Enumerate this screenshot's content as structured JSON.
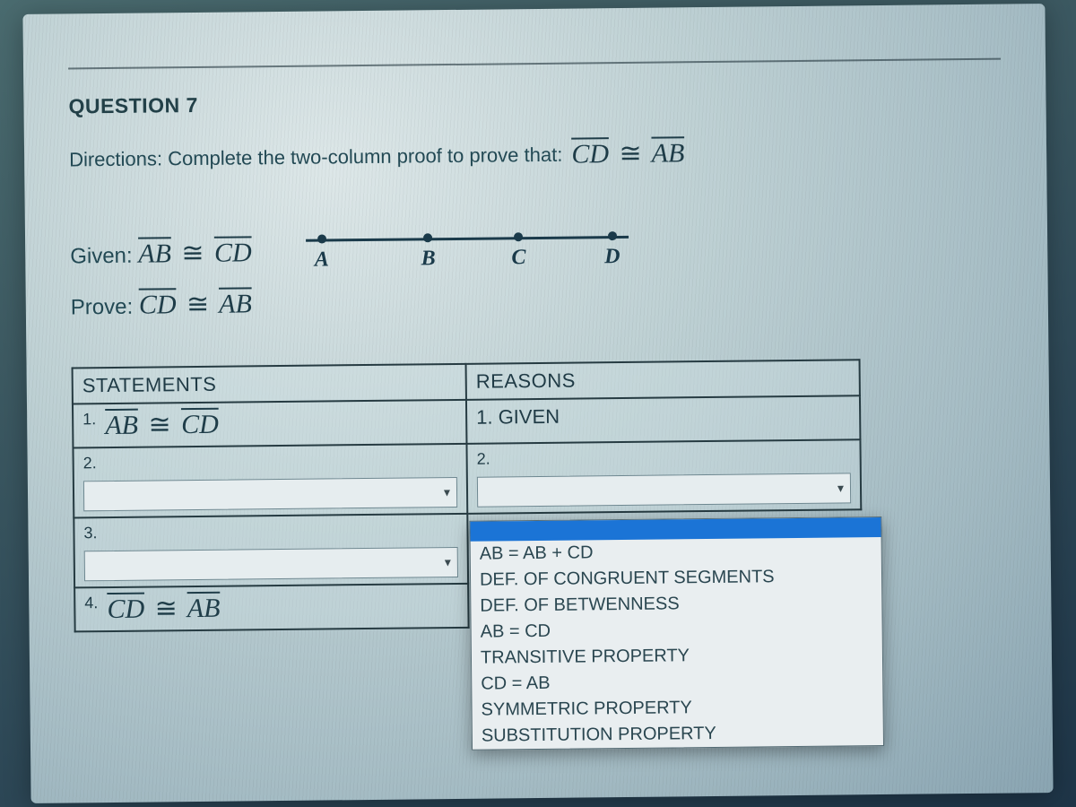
{
  "question": {
    "label": "QUESTION 7",
    "directions_prefix": "Directions: Complete the two-column proof to prove that:",
    "prove_expr_left": "CD",
    "prove_expr_right": "AB"
  },
  "given_prove": {
    "given_label": "Given:",
    "given_left": "AB",
    "given_right": "CD",
    "prove_label": "Prove:",
    "prove_left": "CD",
    "prove_right": "AB"
  },
  "numberline": {
    "points": [
      "A",
      "B",
      "C",
      "D"
    ]
  },
  "proof": {
    "headers": {
      "statements": "STATEMENTS",
      "reasons": "REASONS"
    },
    "rows": [
      {
        "n": "1.",
        "statement_left": "AB",
        "statement_right": "CD",
        "reason": "1. GIVEN"
      },
      {
        "n": "2.",
        "statement": "",
        "reason_n": "2."
      },
      {
        "n": "3.",
        "statement": ""
      },
      {
        "n": "4.",
        "statement_left": "CD",
        "statement_right": "AB"
      }
    ]
  },
  "dropdown": {
    "options": [
      "",
      "AB = AB + CD",
      "DEF. OF CONGRUENT SEGMENTS",
      "DEF. OF BETWENNESS",
      "AB = CD",
      "TRANSITIVE PROPERTY",
      "CD = AB",
      "SYMMETRIC PROPERTY",
      "SUBSTITUTION PROPERTY"
    ],
    "highlighted_index": 0
  },
  "congruent_symbol": "≅"
}
